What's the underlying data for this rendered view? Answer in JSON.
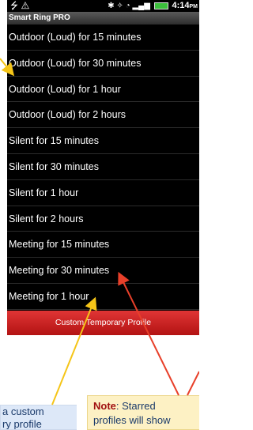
{
  "status_bar": {
    "left_icons": [
      "usb-icon",
      "warning-icon"
    ],
    "right_icons": [
      "bluetooth-icon",
      "vibrate-icon",
      "wifi-icon",
      "signal-icon",
      "battery-icon"
    ],
    "time": "4:14",
    "ampm": "PM",
    "colors": {
      "battery": "#3cbf3c"
    }
  },
  "app": {
    "title": "Smart Ring PRO"
  },
  "profiles": [
    "Outdoor (Loud) for 15 minutes",
    "Outdoor (Loud) for 30 minutes",
    "Outdoor (Loud) for 1 hour",
    "Outdoor (Loud) for 2 hours",
    "Silent for 15 minutes",
    "Silent for 30 minutes",
    "Silent for 1 hour",
    "Silent for 2 hours",
    "Meeting for 15 minutes",
    "Meeting for 30 minutes",
    "Meeting for 1 hour"
  ],
  "custom_button": {
    "label": "Custom Temporary Profile",
    "color": "#c82020"
  },
  "callouts": {
    "left_line1": "a custom",
    "left_line2": "ry profile",
    "right_label": "Note",
    "right_line1_rest": ": Starred",
    "right_line2": "profiles will show"
  },
  "arrow_colors": {
    "yellow": "#f5c518",
    "red": "#e8402a"
  }
}
